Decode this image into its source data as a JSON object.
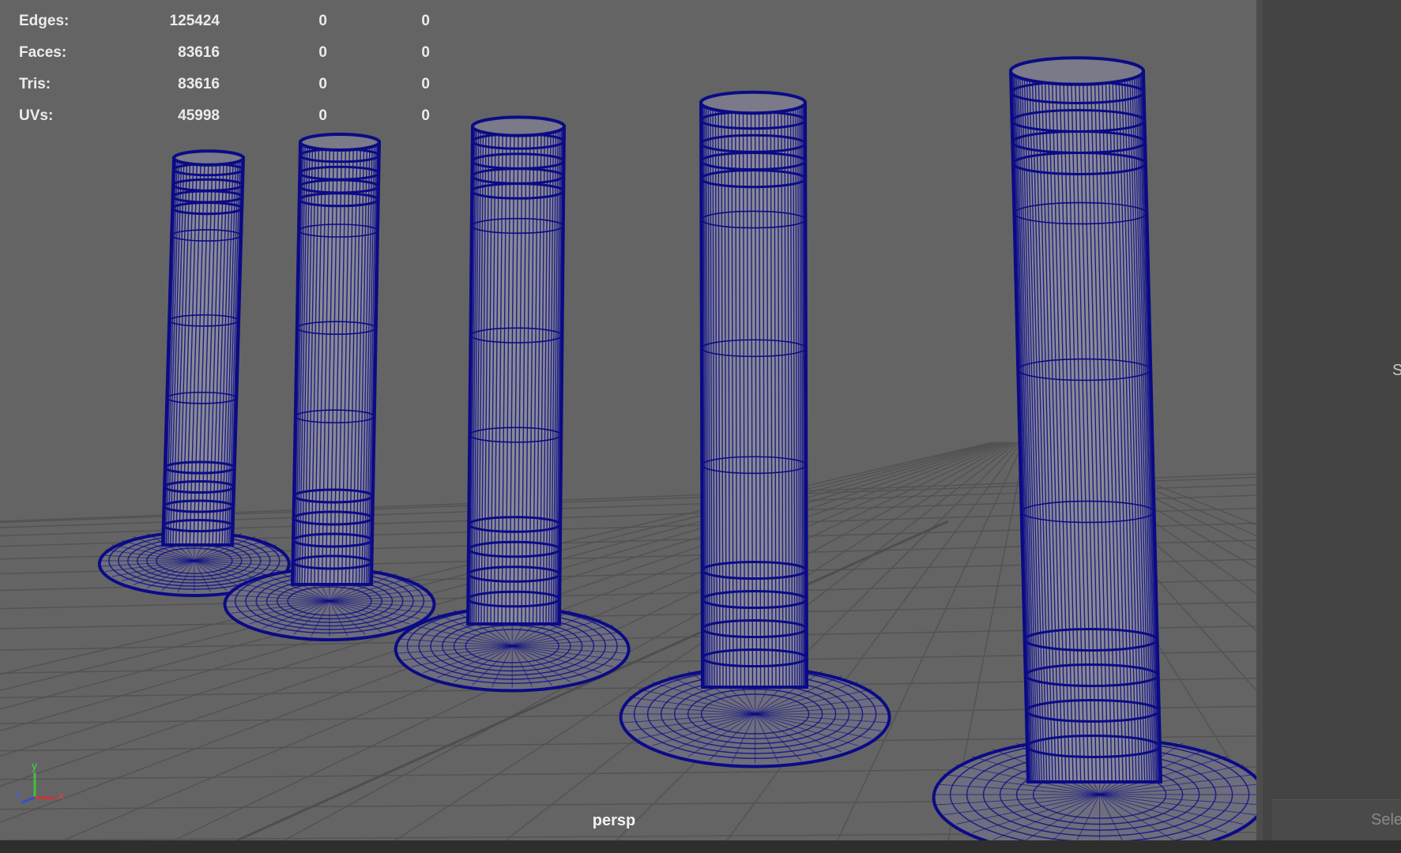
{
  "stats": [
    {
      "label": "Edges:",
      "v1": "125424",
      "v2": "0",
      "v3": "0"
    },
    {
      "label": "Faces:",
      "v1": "83616",
      "v2": "0",
      "v3": "0"
    },
    {
      "label": "Tris:",
      "v1": "83616",
      "v2": "0",
      "v3": "0"
    },
    {
      "label": "UVs:",
      "v1": "45998",
      "v2": "0",
      "v3": "0"
    }
  ],
  "viewport": {
    "camera_label": "persp",
    "background": "#646464",
    "wire_color": "#0b0b86",
    "grid_color": "#525252"
  },
  "axis": {
    "y": "y",
    "z": "z",
    "x": "x"
  },
  "side_panel": {
    "letter": "S",
    "select_label": "Selec"
  }
}
